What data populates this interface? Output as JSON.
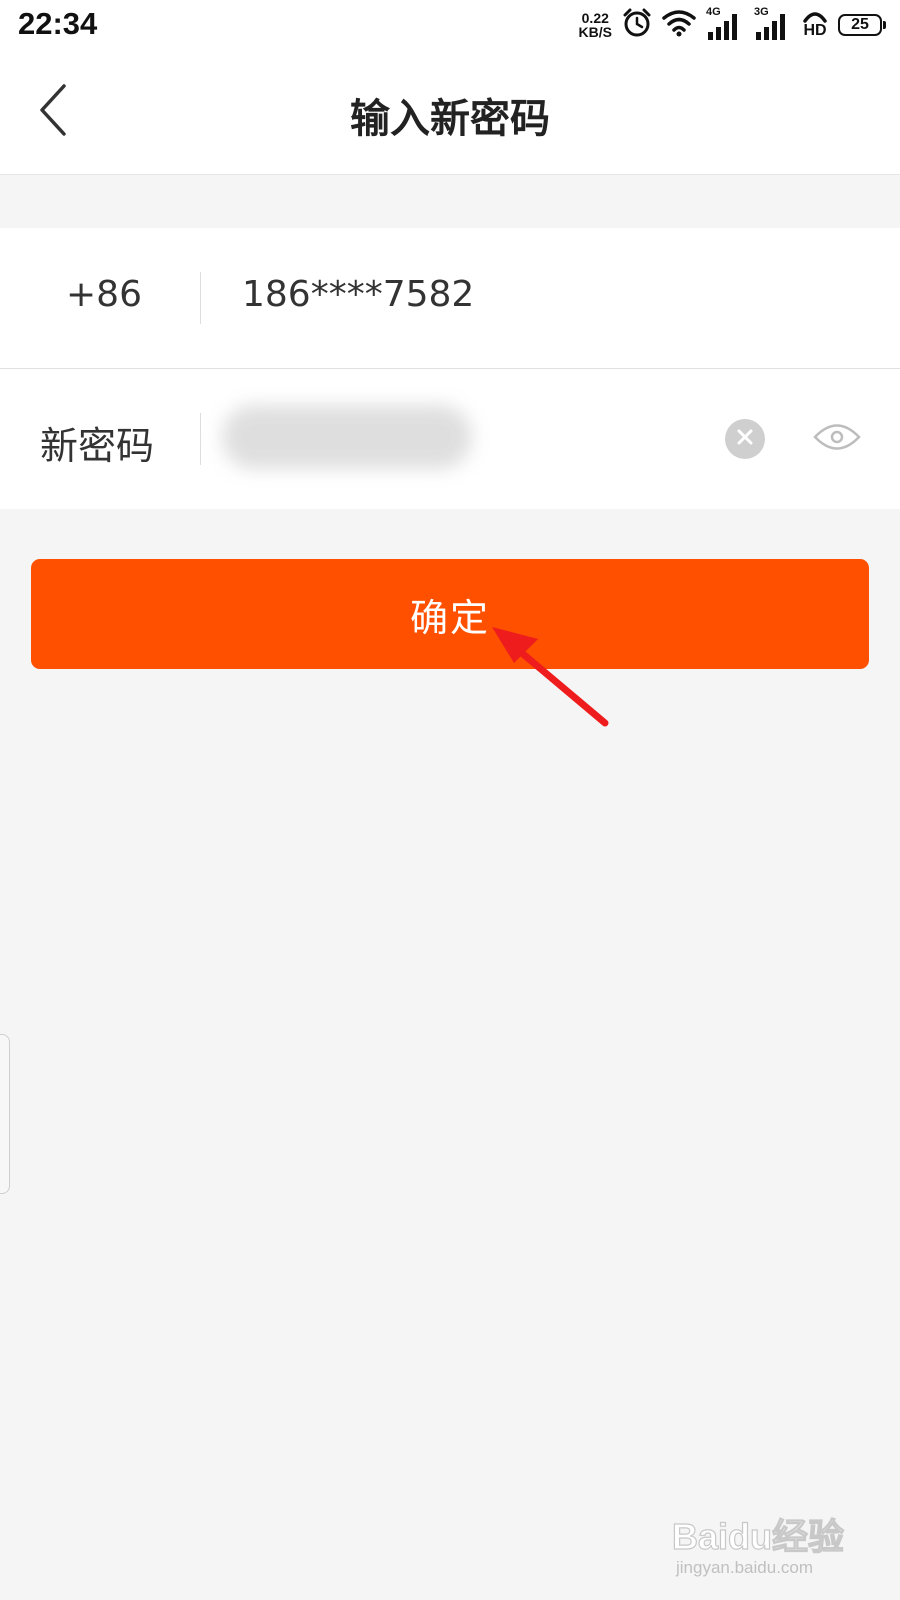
{
  "status_bar": {
    "time": "22:34",
    "net_speed_value": "0.22",
    "net_speed_unit": "KB/S",
    "signal_1_label": "4G",
    "signal_2_label": "3G",
    "hd_label": "HD",
    "battery_level": "25",
    "icons": [
      "alarm-icon",
      "wifi-icon",
      "signal-icon",
      "hd-call-icon",
      "battery-icon"
    ]
  },
  "nav": {
    "title": "输入新密码",
    "back_icon": "chevron-left-icon"
  },
  "form": {
    "country_code": "+86",
    "phone": "186****7582",
    "password_label": "新密码",
    "password_value": "",
    "clear_icon": "clear-icon",
    "visibility_icon": "eye-icon"
  },
  "actions": {
    "confirm_label": "确定"
  },
  "annotation": {
    "arrow_color": "#ee1c1c"
  },
  "watermark": {
    "main": "Baidu经验",
    "sub": "jingyan.baidu.com"
  },
  "colors": {
    "accent": "#ff5000",
    "background": "#f5f5f5",
    "surface": "#ffffff"
  }
}
